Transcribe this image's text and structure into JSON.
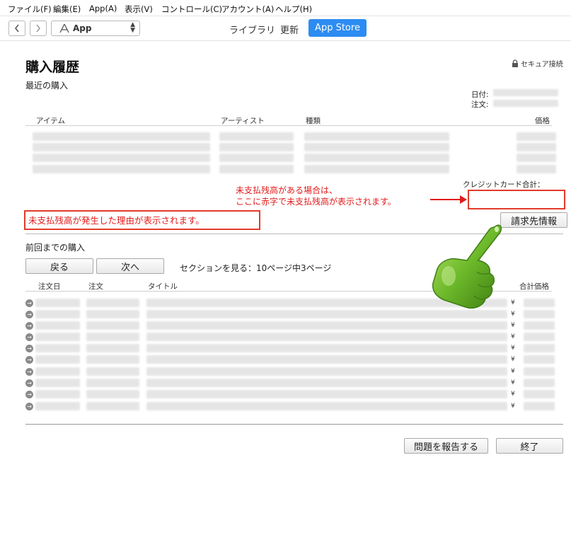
{
  "menubar": {
    "items": [
      "ファイル(F)",
      "編集(E)",
      "App(A)",
      "表示(V)",
      "コントロール(C)",
      "アカウント(A)",
      "ヘルプ(H)"
    ]
  },
  "toolbar": {
    "media_label": "App",
    "tabs": [
      "ライブラリ",
      "更新",
      "App Store"
    ]
  },
  "page": {
    "title": "購入履歴",
    "secure_label": "セキュア接続",
    "recent_heading": "最近の購入",
    "date_label": "日付:",
    "order_label": "注文:",
    "recent_columns": [
      "アイテム",
      "アーティスト",
      "種類",
      "価格"
    ],
    "credit_total_label": "クレジットカード合計：",
    "annotation_balance": [
      "未支払残高がある場合は、",
      "ここに赤字で未支払残高が表示されます。"
    ],
    "annotation_reason": "未支払残高が発生した理由が表示されます。",
    "billing_button": "請求先情報",
    "previous_heading": "前回までの購入",
    "back_button": "戻る",
    "next_button": "次へ",
    "pagination": "セクションを見る：10ページ中3ページ",
    "previous_columns": [
      "注文日",
      "注文",
      "タイトル",
      "合計価格"
    ],
    "yen_symbol": "¥",
    "report_button": "問題を報告する",
    "done_button": "終了"
  },
  "colors": {
    "accent": "#2c8cf2",
    "annotation_red": "#e21a1a",
    "pointer_green": "#5fae1e"
  },
  "icons": [
    "chevron-left-icon",
    "chevron-right-icon",
    "app-store-icon",
    "updown-icon",
    "lock-icon",
    "row-arrow-icon",
    "pointing-hand-icon"
  ]
}
